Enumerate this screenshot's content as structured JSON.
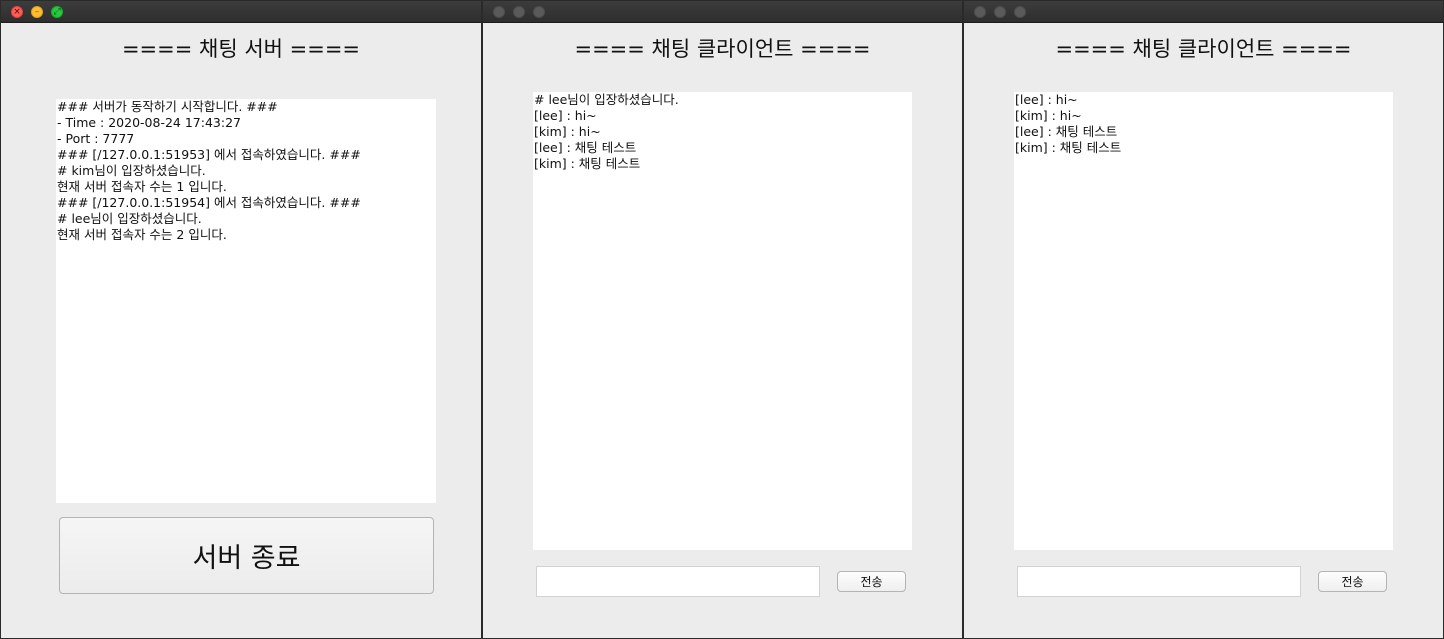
{
  "server": {
    "heading": "==== 채팅 서버 ====",
    "log_lines": [
      "### 서버가 동작하기 시작합니다. ###",
      "- Time : 2020-08-24 17:43:27",
      "- Port : 7777",
      "### [/127.0.0.1:51953] 에서 접속하였습니다. ###",
      "# kim님이 입장하셨습니다.",
      "현재 서버 접속자 수는 1 입니다.",
      "### [/127.0.0.1:51954] 에서 접속하였습니다. ###",
      "# lee님이 입장하셨습니다.",
      "현재 서버 접속자 수는 2 입니다."
    ],
    "shutdown_label": "서버 종료"
  },
  "client1": {
    "heading": "==== 채팅 클라이언트 ====",
    "log_lines": [
      "# lee님이 입장하셨습니다.",
      "[lee] : hi~",
      "[kim] : hi~",
      "[lee] : 채팅 테스트",
      "[kim] : 채팅 테스트"
    ],
    "input_value": "",
    "send_label": "전송"
  },
  "client2": {
    "heading": "==== 채팅 클라이언트 ====",
    "log_lines": [
      "[lee] : hi~",
      "[kim] : hi~",
      "[lee] : 채팅 테스트",
      "[kim] : 채팅 테스트"
    ],
    "input_value": "",
    "send_label": "전송"
  },
  "colors": {
    "window_bg": "#ececec",
    "titlebar": "#2e2e2e",
    "close": "#fe5f57",
    "minimize": "#febc2e",
    "zoom": "#28c840",
    "inactive_light": "#5a5a5a"
  }
}
